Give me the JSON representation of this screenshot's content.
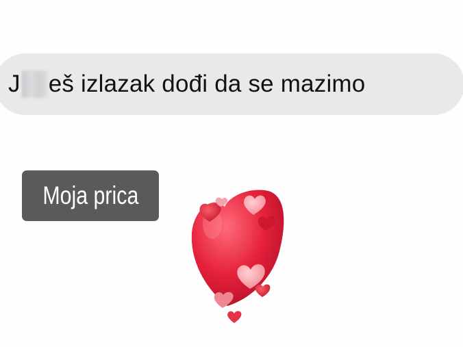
{
  "message": {
    "prefix": "J",
    "suffix": "eš izlazak dođi da se mazimo"
  },
  "story_label": "Moja prica",
  "colors": {
    "bubble": "#e9e9eb",
    "label_bg": "#5a5a5c",
    "heart": "#e5213a"
  },
  "sticker_icon": "hearts-sticker-icon"
}
